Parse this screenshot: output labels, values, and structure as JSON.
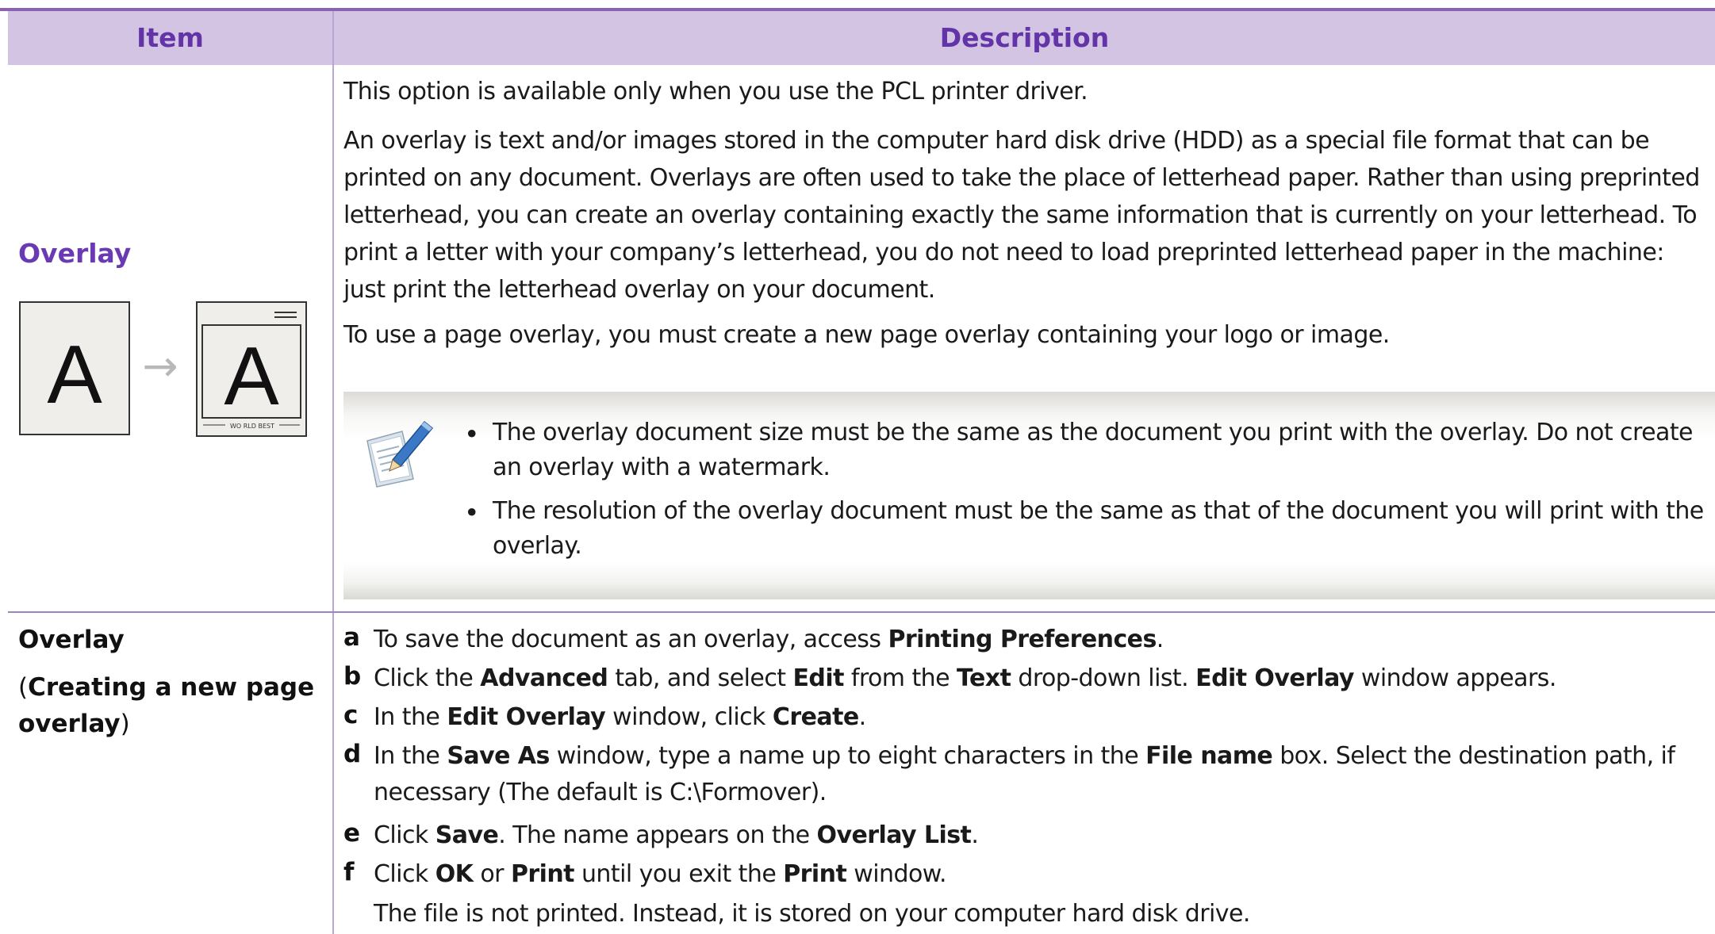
{
  "header": {
    "item": "Item",
    "description": "Description"
  },
  "row1": {
    "item_title": "Overlay",
    "illustration": {
      "letter_before": "A",
      "letter_after": "A",
      "arrow": "→",
      "footer_text": "WO RLD BEST"
    },
    "paragraphs": [
      "This option is available only when you use the PCL printer driver.",
      "An overlay is text and/or images stored in the computer hard disk drive (HDD) as a special file format that can be printed on any document. Overlays are often used to take the place of letterhead paper. Rather than using preprinted letterhead, you can create an overlay containing exactly the same information that is currently on your letterhead. To print a letter with your company’s letterhead, you do not need to load preprinted letterhead paper in the machine: just print the letterhead overlay on your document.",
      "To use a page overlay, you must create a new page overlay containing your logo or image."
    ],
    "note": {
      "icon": "note-pencil-icon",
      "bullet_char": "•",
      "bullets": [
        "The overlay document size must be the same as the document you print with the overlay. Do not create an overlay with a watermark.",
        "The resolution of the overlay document must be the same as that of the document you will print with the overlay."
      ]
    }
  },
  "row2": {
    "item_title": "Overlay",
    "paren_open": "(",
    "item_sub": "Creating a new page",
    "item_sub2": "overlay",
    "paren_close": ")",
    "steps": [
      {
        "letter": "a",
        "parts": [
          {
            "t": "To save the document as an overlay, access "
          },
          {
            "t": "Printing Preferences",
            "b": true
          },
          {
            "t": "."
          }
        ]
      },
      {
        "letter": "b",
        "parts": [
          {
            "t": "Click the "
          },
          {
            "t": "Advanced",
            "b": true
          },
          {
            "t": " tab, and select "
          },
          {
            "t": "Edit",
            "b": true
          },
          {
            "t": " from the "
          },
          {
            "t": "Text",
            "b": true
          },
          {
            "t": " drop-down list. "
          },
          {
            "t": "Edit Overlay",
            "b": true
          },
          {
            "t": " window appears."
          }
        ]
      },
      {
        "letter": "c",
        "parts": [
          {
            "t": "In the "
          },
          {
            "t": "Edit Overlay",
            "b": true
          },
          {
            "t": " window, click "
          },
          {
            "t": "Create",
            "b": true
          },
          {
            "t": "."
          }
        ]
      },
      {
        "letter": "d",
        "parts": [
          {
            "t": "In the "
          },
          {
            "t": "Save As",
            "b": true
          },
          {
            "t": " window, type a name up to eight characters in the "
          },
          {
            "t": "File name",
            "b": true
          },
          {
            "t": " box. Select the destination path, if necessary (The default is C:\\Formover)."
          }
        ]
      },
      {
        "letter": "e",
        "parts": [
          {
            "t": "Click "
          },
          {
            "t": "Save",
            "b": true
          },
          {
            "t": ". The name appears on the "
          },
          {
            "t": "Overlay List",
            "b": true
          },
          {
            "t": "."
          }
        ]
      },
      {
        "letter": "f",
        "parts": [
          {
            "t": "Click "
          },
          {
            "t": "OK",
            "b": true
          },
          {
            "t": " or "
          },
          {
            "t": "Print",
            "b": true
          },
          {
            "t": " until you exit the "
          },
          {
            "t": "Print",
            "b": true
          },
          {
            "t": " window."
          }
        ]
      }
    ],
    "final_note": "The file is not printed. Instead, it is stored on your computer hard disk drive."
  },
  "colors": {
    "header_bg": "#d4c4e4",
    "header_text": "#6234a7",
    "rule": "#8a63ae",
    "item_title": "#6a3ab4"
  }
}
